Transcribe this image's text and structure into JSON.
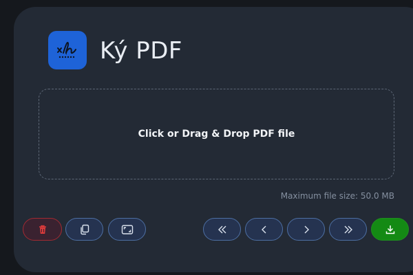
{
  "app": {
    "title": "Ký PDF",
    "logo_icon": "signature-icon",
    "accent": "#1e63d8"
  },
  "upload": {
    "dropzone_label": "Click or Drag & Drop PDF file",
    "max_size_text": "Maximum file size: 50.0 MB"
  },
  "toolbar": {
    "left_buttons": [
      {
        "name": "delete-button",
        "icon": "trash-icon",
        "color": "#dd3b3b"
      },
      {
        "name": "duplicate-button",
        "icon": "copy-icon"
      },
      {
        "name": "fit-button",
        "icon": "fit-screen-icon"
      }
    ],
    "right_buttons": [
      {
        "name": "first-page-button",
        "icon": "double-chevron-left-icon"
      },
      {
        "name": "prev-page-button",
        "icon": "chevron-left-icon"
      },
      {
        "name": "next-page-button",
        "icon": "chevron-right-icon"
      },
      {
        "name": "last-page-button",
        "icon": "double-chevron-right-icon"
      },
      {
        "name": "download-button",
        "icon": "download-icon",
        "color": "#148a14"
      }
    ]
  }
}
